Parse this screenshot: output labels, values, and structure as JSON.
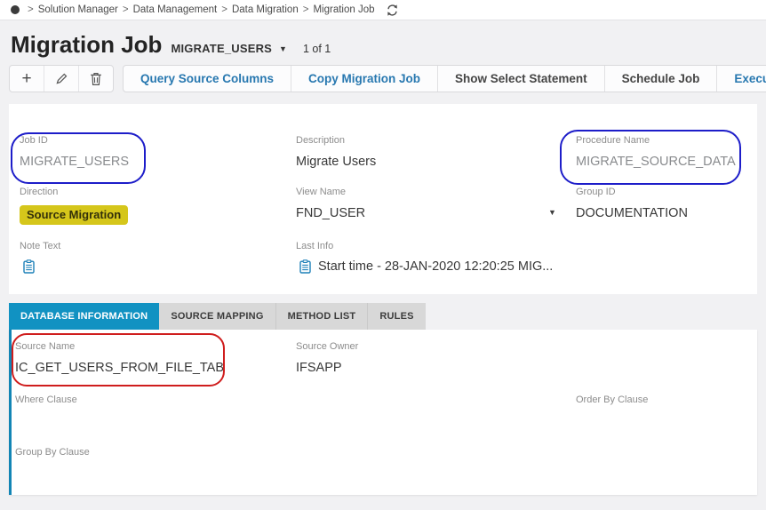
{
  "breadcrumb": {
    "separator": ">",
    "items": [
      "Solution Manager",
      "Data Management",
      "Data Migration",
      "Migration Job"
    ]
  },
  "header": {
    "title": "Migration Job",
    "record_id": "MIGRATE_USERS",
    "record_count": "1 of 1"
  },
  "toolbar": {
    "icon_buttons": [
      {
        "name": "add"
      },
      {
        "name": "edit"
      },
      {
        "name": "delete"
      }
    ],
    "commands": [
      {
        "label": "Query Source Columns",
        "emphasis": "accent"
      },
      {
        "label": "Copy Migration Job",
        "emphasis": "accent"
      },
      {
        "label": "Show Select Statement",
        "emphasis": "default"
      },
      {
        "label": "Schedule Job",
        "emphasis": "default"
      },
      {
        "label": "Execute Job",
        "emphasis": "accent"
      }
    ]
  },
  "form": {
    "fields": {
      "job_id": {
        "label": "Job ID",
        "value": "MIGRATE_USERS"
      },
      "description": {
        "label": "Description",
        "value": "Migrate Users"
      },
      "procedure_name": {
        "label": "Procedure Name",
        "value": "MIGRATE_SOURCE_DATA"
      },
      "direction": {
        "label": "Direction",
        "value": "Source Migration"
      },
      "view_name": {
        "label": "View Name",
        "value": "FND_USER"
      },
      "group_id": {
        "label": "Group ID",
        "value": "DOCUMENTATION"
      },
      "note_text": {
        "label": "Note Text"
      },
      "last_info": {
        "label": "Last Info",
        "value": "Start time - 28-JAN-2020 12:20:25   MIG..."
      }
    }
  },
  "tabs": {
    "active": "DATABASE INFORMATION",
    "items": [
      {
        "label": "DATABASE INFORMATION"
      },
      {
        "label": "SOURCE MAPPING"
      },
      {
        "label": "METHOD LIST"
      },
      {
        "label": "RULES"
      }
    ]
  },
  "tab_content": {
    "fields": {
      "source_name": {
        "label": "Source Name",
        "value": "IC_GET_USERS_FROM_FILE_TAB"
      },
      "source_owner": {
        "label": "Source Owner",
        "value": "IFSAPP"
      },
      "where_clause": {
        "label": "Where Clause",
        "value": ""
      },
      "order_by_clause": {
        "label": "Order By Clause",
        "value": ""
      },
      "group_by_clause": {
        "label": "Group By Clause",
        "value": ""
      }
    }
  },
  "colors": {
    "accent_blue": "#2878b0",
    "active_tab_blue": "#1192c2",
    "badge_yellow": "#d5c61b",
    "annotation_blue": "#1d1dc9",
    "annotation_red": "#cf1d1d",
    "note_icon_blue": "#1d80b8"
  }
}
